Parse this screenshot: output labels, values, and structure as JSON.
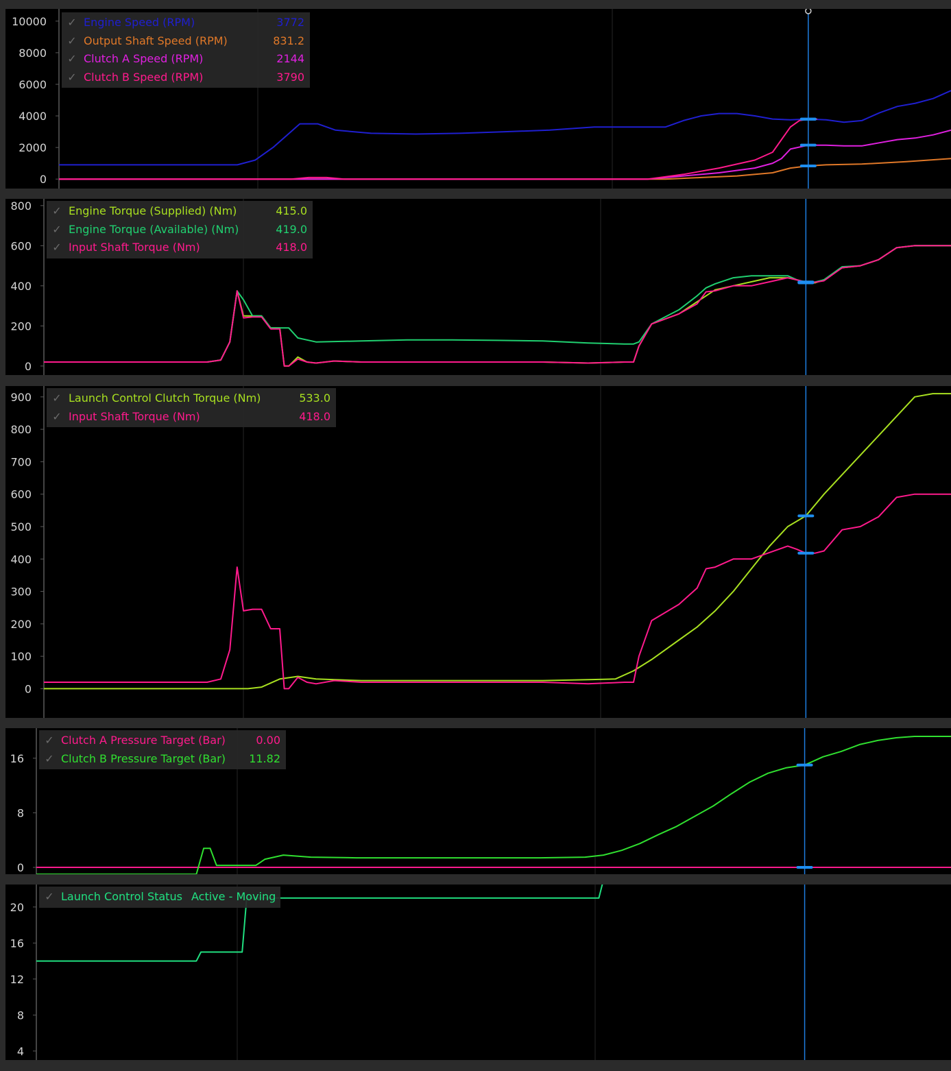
{
  "charts": [
    {
      "id": "speed",
      "legend": [
        {
          "name": "Engine Speed (RPM)",
          "value": "3772",
          "color": "#1f1fd0"
        },
        {
          "name": "Output Shaft Speed (RPM)",
          "value": "831.2",
          "color": "#e07828"
        },
        {
          "name": "Clutch A Speed (RPM)",
          "value": "2144",
          "color": "#e020e0"
        },
        {
          "name": "Clutch B Speed (RPM)",
          "value": "3790",
          "color": "#ff1a8c"
        }
      ]
    },
    {
      "id": "torque",
      "legend": [
        {
          "name": "Engine Torque (Supplied) (Nm)",
          "value": "415.0",
          "color": "#a8e020"
        },
        {
          "name": "Engine Torque (Available) (Nm)",
          "value": "419.0",
          "color": "#20d070"
        },
        {
          "name": "Input Shaft Torque (Nm)",
          "value": "418.0",
          "color": "#ff1a8c"
        }
      ]
    },
    {
      "id": "launch-torque",
      "legend": [
        {
          "name": "Launch Control Clutch Torque (Nm)",
          "value": "533.0",
          "color": "#a8e020"
        },
        {
          "name": "Input Shaft Torque (Nm)",
          "value": "418.0",
          "color": "#ff1a8c"
        }
      ]
    },
    {
      "id": "pressure",
      "legend": [
        {
          "name": "Clutch A Pressure Target (Bar)",
          "value": "0.00",
          "color": "#ff1a8c"
        },
        {
          "name": "Clutch B Pressure Target (Bar)",
          "value": "11.82",
          "color": "#30e030"
        }
      ]
    },
    {
      "id": "status",
      "legend": [
        {
          "name": "Launch Control Status",
          "value": "Active - Moving",
          "color": "#20e080"
        }
      ]
    }
  ],
  "chart_data": [
    {
      "type": "line",
      "xlim": [
        0,
        100
      ],
      "ylim": [
        -600,
        10600
      ],
      "yticks": [
        0,
        2000,
        4000,
        6000,
        8000,
        10000
      ],
      "cursor_x": 84,
      "grid": true,
      "series": [
        {
          "name": "Engine Speed (RPM)",
          "color": "#1f1fd0",
          "x": [
            0,
            20,
            22,
            24,
            26,
            27,
            29,
            31,
            35,
            40,
            45,
            50,
            55,
            60,
            65,
            68,
            70,
            72,
            74,
            76,
            78,
            80,
            82,
            84,
            86,
            88,
            90,
            92,
            94,
            96,
            98,
            100
          ],
          "y": [
            900,
            900,
            1200,
            2000,
            3000,
            3500,
            3500,
            3100,
            2900,
            2850,
            2900,
            3000,
            3100,
            3300,
            3300,
            3300,
            3700,
            4000,
            4150,
            4150,
            4000,
            3800,
            3750,
            3800,
            3750,
            3600,
            3700,
            4200,
            4600,
            4800,
            5100,
            5600
          ]
        },
        {
          "name": "Output Shaft Speed (RPM)",
          "color": "#e07828",
          "x": [
            0,
            68,
            72,
            76,
            80,
            82,
            84,
            86,
            90,
            95,
            100
          ],
          "y": [
            0,
            0,
            100,
            200,
            400,
            700,
            831,
            900,
            950,
            1100,
            1300
          ]
        },
        {
          "name": "Clutch A Speed (RPM)",
          "color": "#e020e0",
          "x": [
            0,
            66,
            70,
            74,
            78,
            80,
            81,
            82,
            84,
            86,
            88,
            90,
            92,
            94,
            96,
            98,
            100
          ],
          "y": [
            0,
            0,
            200,
            400,
            700,
            1000,
            1300,
            1900,
            2150,
            2150,
            2100,
            2100,
            2300,
            2500,
            2600,
            2800,
            3100
          ]
        },
        {
          "name": "Clutch B Speed (RPM)",
          "color": "#ff1a8c",
          "x": [
            0,
            26,
            28,
            30,
            32,
            66,
            70,
            74,
            78,
            80,
            81,
            82,
            83,
            84,
            85
          ],
          "y": [
            0,
            0,
            100,
            100,
            0,
            0,
            300,
            700,
            1200,
            1700,
            2500,
            3300,
            3700,
            3790,
            3800
          ]
        }
      ]
    },
    {
      "type": "line",
      "xlim": [
        0,
        100
      ],
      "ylim": [
        -45,
        820
      ],
      "yticks": [
        0,
        200,
        400,
        600,
        800
      ],
      "cursor_x": 84,
      "grid": true,
      "series": [
        {
          "name": "Engine Torque (Supplied) (Nm)",
          "color": "#a8e020",
          "x": [
            0,
            17,
            18,
            19.5,
            20.5,
            21.3,
            22,
            23,
            24,
            25,
            26,
            26.5,
            27,
            28,
            29,
            30,
            32,
            35,
            40,
            45,
            50,
            55,
            60,
            64,
            65,
            65.6,
            67,
            70,
            72,
            74,
            76,
            78,
            80,
            82,
            83,
            84,
            85,
            86,
            88,
            90,
            92,
            94,
            96,
            98,
            100
          ],
          "y": [
            20,
            20,
            20,
            30,
            120,
            375,
            250,
            250,
            250,
            190,
            190,
            0,
            0,
            45,
            20,
            15,
            25,
            20,
            20,
            20,
            20,
            20,
            15,
            20,
            20,
            100,
            210,
            260,
            320,
            380,
            400,
            420,
            440,
            440,
            430,
            415,
            415,
            430,
            490,
            500,
            530,
            590,
            600,
            600,
            600
          ]
        },
        {
          "name": "Engine Torque (Available) (Nm)",
          "color": "#20d070",
          "x": [
            0,
            17,
            18,
            19.5,
            20.5,
            21.3,
            22,
            23,
            24,
            25,
            26,
            27,
            28,
            30,
            35,
            40,
            45,
            50,
            55,
            60,
            64,
            65,
            65.6,
            67,
            70,
            72,
            73,
            74,
            76,
            78,
            80,
            82,
            83,
            84,
            85,
            86,
            88,
            90,
            92,
            94,
            96,
            98,
            100
          ],
          "y": [
            20,
            20,
            20,
            30,
            120,
            375,
            330,
            250,
            250,
            190,
            190,
            190,
            140,
            120,
            125,
            130,
            130,
            128,
            125,
            115,
            110,
            110,
            120,
            210,
            280,
            350,
            390,
            410,
            440,
            450,
            450,
            450,
            430,
            419,
            419,
            430,
            495,
            500,
            530,
            590,
            600,
            600,
            600
          ]
        },
        {
          "name": "Input Shaft Torque (Nm)",
          "color": "#ff1a8c",
          "x": [
            0,
            17,
            18,
            19.5,
            20.5,
            21.3,
            22,
            23,
            24,
            25,
            26,
            26.5,
            27,
            28,
            29,
            30,
            32,
            35,
            40,
            45,
            50,
            55,
            60,
            64,
            65,
            65.6,
            67,
            70,
            72,
            73,
            74,
            76,
            78,
            80,
            82,
            83,
            84,
            85,
            86,
            88,
            90,
            92,
            94,
            96,
            98,
            100
          ],
          "y": [
            20,
            20,
            20,
            30,
            120,
            375,
            240,
            245,
            245,
            185,
            185,
            0,
            0,
            35,
            20,
            15,
            25,
            20,
            20,
            20,
            20,
            20,
            15,
            20,
            20,
            100,
            210,
            260,
            310,
            370,
            375,
            400,
            400,
            420,
            440,
            430,
            418,
            418,
            425,
            490,
            500,
            530,
            590,
            600,
            600,
            600
          ]
        }
      ]
    },
    {
      "type": "line",
      "xlim": [
        0,
        100
      ],
      "ylim": [
        -90,
        925
      ],
      "yticks": [
        0,
        100,
        200,
        300,
        400,
        500,
        600,
        700,
        800,
        900
      ],
      "cursor_x": 84,
      "grid": true,
      "series": [
        {
          "name": "Launch Control Clutch Torque (Nm)",
          "color": "#a8e020",
          "x": [
            0,
            22.5,
            24,
            26,
            28,
            30,
            35,
            40,
            45,
            50,
            55,
            60,
            63,
            65,
            67,
            70,
            72,
            74,
            76,
            78,
            80,
            82,
            84,
            86,
            88,
            90,
            92,
            94,
            96,
            98,
            100
          ],
          "y": [
            0,
            0,
            5,
            30,
            38,
            30,
            25,
            25,
            25,
            25,
            25,
            28,
            30,
            55,
            90,
            150,
            190,
            240,
            300,
            370,
            440,
            500,
            533,
            600,
            660,
            720,
            780,
            840,
            900,
            910,
            910
          ]
        },
        {
          "name": "Input Shaft Torque (Nm)",
          "color": "#ff1a8c",
          "x": [
            0,
            17,
            18,
            19.5,
            20.5,
            21.3,
            22,
            23,
            24,
            25,
            26,
            26.5,
            27,
            28,
            29,
            30,
            32,
            35,
            40,
            45,
            50,
            55,
            60,
            64,
            65,
            65.6,
            67,
            70,
            72,
            73,
            74,
            76,
            78,
            80,
            82,
            83,
            84,
            85,
            86,
            88,
            90,
            92,
            94,
            96,
            98,
            100
          ],
          "y": [
            20,
            20,
            20,
            30,
            120,
            375,
            240,
            245,
            245,
            185,
            185,
            0,
            0,
            35,
            20,
            15,
            25,
            20,
            20,
            20,
            20,
            20,
            15,
            20,
            20,
            100,
            210,
            260,
            310,
            370,
            375,
            400,
            400,
            420,
            440,
            430,
            418,
            418,
            425,
            490,
            500,
            530,
            590,
            600,
            600,
            600
          ]
        }
      ]
    },
    {
      "type": "line",
      "xlim": [
        0,
        100
      ],
      "ylim": [
        -1,
        20
      ],
      "yticks": [
        0,
        8,
        16
      ],
      "cursor_x": 84,
      "grid": true,
      "series": [
        {
          "name": "Clutch A Pressure Target (Bar)",
          "color": "#ff1a8c",
          "x": [
            0,
            100
          ],
          "y": [
            0,
            0
          ]
        },
        {
          "name": "Clutch B Pressure Target (Bar)",
          "color": "#30e030",
          "x": [
            0,
            17.5,
            18.3,
            19,
            19.7,
            24,
            25,
            27,
            30,
            35,
            40,
            45,
            50,
            55,
            60,
            62,
            64,
            66,
            68,
            70,
            72,
            74,
            76,
            78,
            80,
            82,
            84,
            86,
            88,
            90,
            92,
            94,
            96,
            98,
            100
          ],
          "y": [
            -1,
            -1,
            2.8,
            2.8,
            0.3,
            0.3,
            1.2,
            1.8,
            1.5,
            1.4,
            1.4,
            1.4,
            1.4,
            1.4,
            1.5,
            1.8,
            2.5,
            3.5,
            4.8,
            6,
            7.5,
            9,
            10.8,
            12.5,
            13.8,
            14.6,
            15,
            16.2,
            17,
            18,
            18.6,
            19,
            19.2,
            19.2,
            19.2
          ]
        }
      ]
    },
    {
      "type": "line",
      "xlim": [
        0,
        100
      ],
      "ylim": [
        3,
        22.5
      ],
      "yticks": [
        4,
        8,
        12,
        16,
        20
      ],
      "cursor_x": 84,
      "grid": true,
      "series": [
        {
          "name": "Launch Control Status",
          "color": "#20e080",
          "x": [
            0,
            17.5,
            18,
            22.5,
            23,
            61.5,
            62,
            100
          ],
          "y": [
            14,
            14,
            15,
            15,
            21,
            21,
            23,
            23
          ]
        }
      ]
    }
  ]
}
